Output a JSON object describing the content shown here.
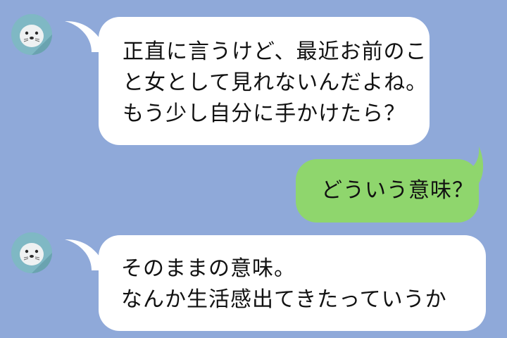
{
  "chat": {
    "colors": {
      "background": "#8fa9d9",
      "incoming_bubble": "#ffffff",
      "outgoing_bubble": "#8fd66d",
      "avatar_background": "#7fb8c4"
    },
    "contact": {
      "avatar_icon": "seal-icon"
    },
    "messages": [
      {
        "sender": "contact",
        "lines": [
          "正直に言うけど、最近お前のこ",
          "と女として見れないんだよね。",
          "もう少し自分に手かけたら？"
        ]
      },
      {
        "sender": "me",
        "lines": [
          "どういう意味？"
        ]
      },
      {
        "sender": "contact",
        "lines": [
          "そのままの意味。",
          "なんか生活感出てきたっていうか"
        ]
      }
    ]
  }
}
